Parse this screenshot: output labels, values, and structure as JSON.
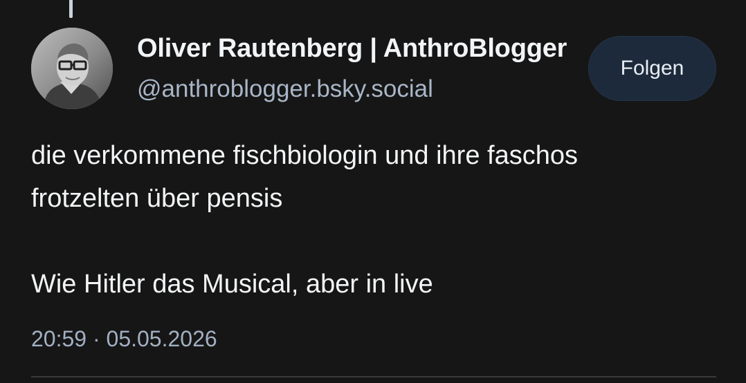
{
  "post": {
    "author": {
      "display_name": "Oliver Rautenberg | AnthroBlogger",
      "handle": "@anthroblogger.bsky.social",
      "avatar_icon": "profile-photo"
    },
    "follow_button": {
      "label": "Folgen"
    },
    "body": {
      "line_1": "die verkommene fischbiologin und ihre faschos",
      "line_2": "frotzelten über pensis",
      "line_3": "Wie Hitler das Musical, aber in live"
    },
    "timestamp": "20:59 · 05.05.2026"
  },
  "colors": {
    "background": "#161616",
    "text_primary": "#f3f5f7",
    "text_secondary": "#a9b6c7",
    "button_background": "#1d2a3b",
    "thread_line": "#c9d3df"
  }
}
